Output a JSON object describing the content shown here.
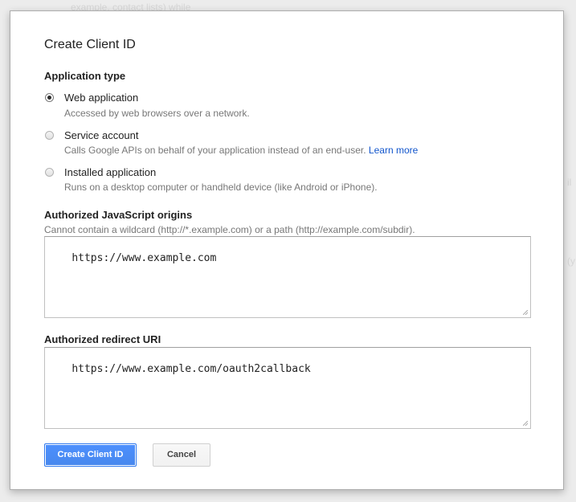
{
  "background": {
    "top_text": "example, contact lists) while",
    "right_text_1": "il",
    "right_text_2": "(y"
  },
  "dialog": {
    "title": "Create Client ID",
    "application_type": {
      "label": "Application type",
      "options": [
        {
          "label": "Web application",
          "description": "Accessed by web browsers over a network.",
          "selected": true
        },
        {
          "label": "Service account",
          "description": "Calls Google APIs on behalf of your application instead of an end-user.",
          "link": "Learn more",
          "selected": false
        },
        {
          "label": "Installed application",
          "description": "Runs on a desktop computer or handheld device (like Android or iPhone).",
          "selected": false
        }
      ]
    },
    "origins": {
      "label": "Authorized JavaScript origins",
      "hint": "Cannot contain a wildcard (http://*.example.com) or a path (http://example.com/subdir).",
      "value": "https://www.example.com"
    },
    "redirect": {
      "label": "Authorized redirect URI",
      "value": "https://www.example.com/oauth2callback"
    },
    "buttons": {
      "create": "Create Client ID",
      "cancel": "Cancel"
    },
    "colors": {
      "primary": "#4d90fe",
      "link": "#1155cc"
    }
  }
}
